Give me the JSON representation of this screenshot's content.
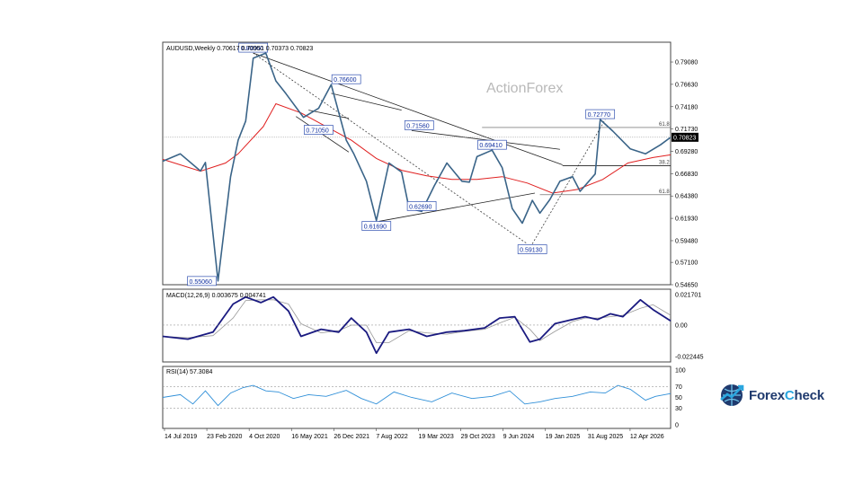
{
  "chart_data": {
    "type": "line",
    "symbol_header": "AUDUSD,Weekly  0.70617 0.70951 0.70373 0.70823",
    "watermark": "ActionForex",
    "current_price": "0.70823",
    "x_tick_labels": [
      "14 Jul 2019",
      "23 Feb 2020",
      "4 Oct 2020",
      "16 May 2021",
      "26 Dec 2021",
      "7 Aug 2022",
      "19 Mar 2023",
      "29 Oct 2023",
      "9 Jun 2024",
      "19 Jan 2025",
      "31 Aug 2025",
      "12 Apr 2026"
    ],
    "price_axis": {
      "ticks": [
        "0.79080",
        "0.76630",
        "0.74180",
        "0.71730",
        "0.69280",
        "0.66830",
        "0.64380",
        "0.61930",
        "0.59480",
        "0.57100",
        "0.54650"
      ],
      "ylim": [
        0.5465,
        0.8125
      ]
    },
    "price_series": {
      "name": "AUDUSD",
      "x": [
        0,
        14,
        30,
        34,
        38,
        44,
        54,
        60,
        66,
        72,
        82,
        90,
        98,
        112,
        124,
        134,
        146,
        152,
        162,
        170,
        180,
        190,
        196,
        206,
        216,
        226,
        238,
        244,
        250,
        262,
        270,
        278,
        286,
        294,
        300,
        308,
        316,
        326,
        332,
        344,
        348,
        358,
        372,
        384,
        396,
        404
      ],
      "values": [
        0.682,
        0.69,
        0.6712,
        0.6806,
        0.6285,
        0.5506,
        0.665,
        0.705,
        0.726,
        0.795,
        0.8006,
        0.77,
        0.756,
        0.73,
        0.74,
        0.766,
        0.705,
        0.69,
        0.66,
        0.6169,
        0.68,
        0.67,
        0.63,
        0.6269,
        0.655,
        0.68,
        0.66,
        0.659,
        0.687,
        0.6941,
        0.675,
        0.63,
        0.614,
        0.639,
        0.625,
        0.64,
        0.66,
        0.665,
        0.649,
        0.668,
        0.7277,
        0.715,
        0.6955,
        0.69,
        0.7,
        0.7082
      ]
    },
    "moving_average": {
      "x": [
        0,
        30,
        50,
        60,
        80,
        90,
        110,
        130,
        150,
        170,
        190,
        210,
        230,
        250,
        270,
        290,
        310,
        330,
        350,
        370,
        390,
        404
      ],
      "values": [
        0.684,
        0.671,
        0.68,
        0.69,
        0.72,
        0.745,
        0.735,
        0.72,
        0.705,
        0.685,
        0.672,
        0.666,
        0.662,
        0.662,
        0.665,
        0.658,
        0.647,
        0.651,
        0.662,
        0.68,
        0.686,
        0.689
      ]
    },
    "price_labels": [
      {
        "text": "0.80060",
        "x": 72,
        "y": 0.8006
      },
      {
        "text": "0.76600",
        "x": 146,
        "y": 0.766
      },
      {
        "text": "0.71560",
        "x": 204,
        "y": 0.7156
      },
      {
        "text": "0.71050",
        "x": 124,
        "y": 0.7105
      },
      {
        "text": "0.69410",
        "x": 262,
        "y": 0.6941
      },
      {
        "text": "0.72770",
        "x": 348,
        "y": 0.7277
      },
      {
        "text": "0.62690",
        "x": 206,
        "y": 0.6269
      },
      {
        "text": "0.61690",
        "x": 170,
        "y": 0.6169
      },
      {
        "text": "0.59130",
        "x": 294,
        "y": 0.5913
      },
      {
        "text": "0.55060",
        "x": 44,
        "y": 0.5506
      }
    ],
    "fib_lines": [
      {
        "label": "61.8",
        "y": 0.719
      },
      {
        "label": "38.2",
        "y": 0.677
      },
      {
        "label": "61.8",
        "y": 0.6452
      }
    ],
    "macd_panel": {
      "label": "MACD(12,26,9) 0.003675 0.004741",
      "ticks": [
        "0.021701",
        "0.00",
        "-0.022445"
      ],
      "ylim": [
        -0.0224,
        0.0217
      ],
      "x": [
        0,
        20,
        40,
        56,
        66,
        78,
        88,
        100,
        110,
        126,
        140,
        150,
        162,
        170,
        180,
        196,
        210,
        226,
        240,
        256,
        268,
        280,
        292,
        300,
        312,
        326,
        336,
        346,
        356,
        366,
        380,
        390,
        404
      ],
      "values": [
        -0.008,
        -0.01,
        -0.005,
        0.015,
        0.02,
        0.016,
        0.02,
        0.01,
        -0.008,
        -0.003,
        -0.005,
        0.005,
        -0.005,
        -0.02,
        -0.005,
        -0.003,
        -0.008,
        -0.005,
        -0.004,
        -0.002,
        0.005,
        0.006,
        -0.012,
        -0.01,
        0.001,
        0.004,
        0.006,
        0.004,
        0.008,
        0.006,
        0.018,
        0.011,
        0.003
      ]
    },
    "rsi_panel": {
      "label": "RSI(14) 57.3084",
      "ticks": [
        "100",
        "70",
        "50",
        "30",
        "0"
      ],
      "ylim": [
        0,
        100
      ],
      "x": [
        0,
        14,
        24,
        34,
        44,
        54,
        64,
        72,
        82,
        92,
        104,
        116,
        130,
        146,
        158,
        170,
        184,
        198,
        214,
        230,
        246,
        262,
        276,
        288,
        300,
        312,
        326,
        340,
        352,
        362,
        372,
        384,
        392,
        404
      ],
      "values": [
        50,
        55,
        38,
        62,
        35,
        58,
        68,
        72,
        62,
        60,
        48,
        55,
        52,
        63,
        48,
        38,
        60,
        50,
        42,
        58,
        48,
        52,
        62,
        38,
        42,
        48,
        52,
        60,
        58,
        72,
        65,
        45,
        52,
        57
      ]
    }
  }
}
